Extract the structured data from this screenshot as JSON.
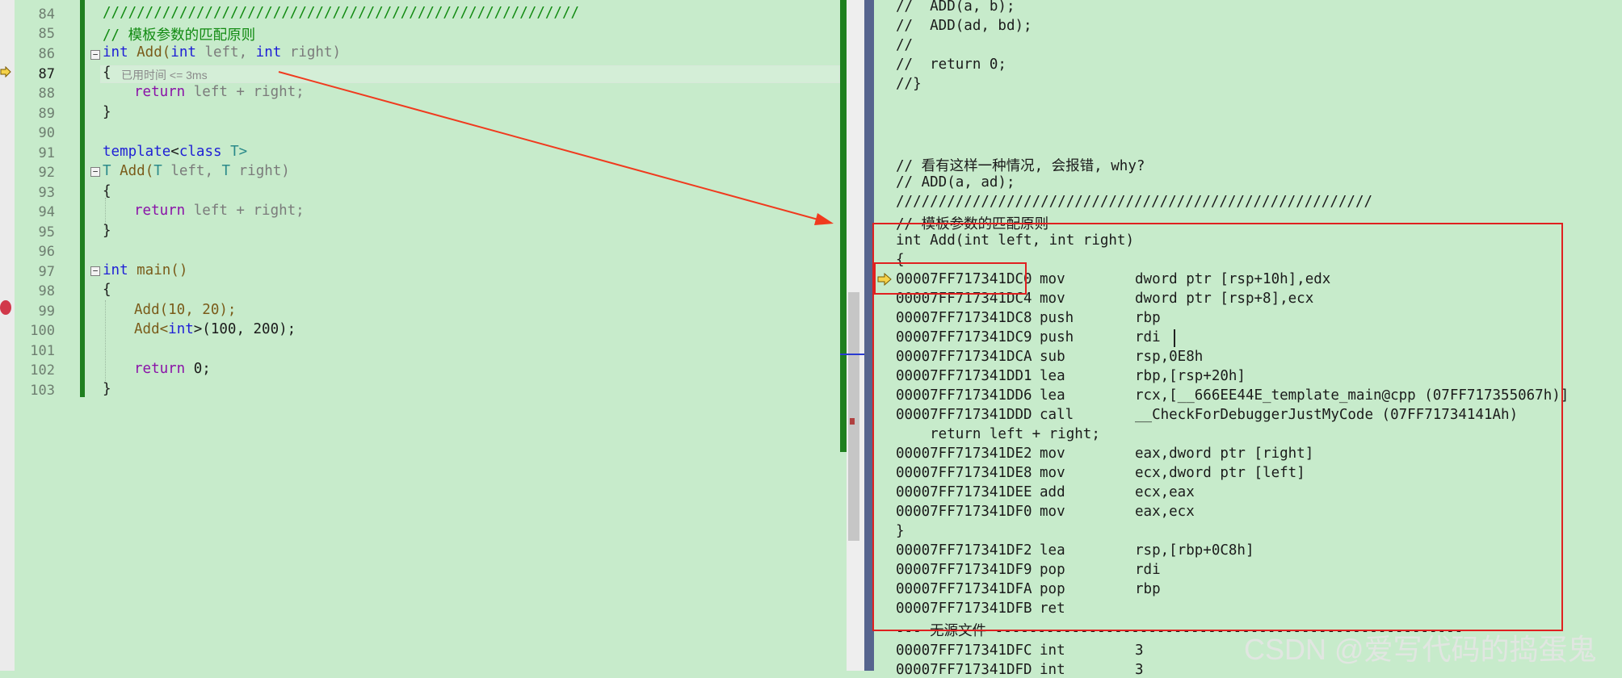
{
  "left_editor": {
    "elapsed_hint": "已用时间 <= 3ms",
    "lines": [
      {
        "n": "84",
        "t": "////////////////////////////////////////////////////////"
      },
      {
        "n": "85",
        "t": "// 模板参数的匹配原则"
      },
      {
        "n": "86",
        "a": "int",
        "b": " Add(",
        "c": "int",
        "d": " left, ",
        "e": "int",
        "f": " right)"
      },
      {
        "n": "87",
        "t": "{"
      },
      {
        "n": "88",
        "a": "return",
        "b": " left + right;"
      },
      {
        "n": "89",
        "t": "}"
      },
      {
        "n": "90",
        "t": ""
      },
      {
        "n": "91",
        "a": "template",
        "b": "<",
        "c": "class",
        "d": " T>"
      },
      {
        "n": "92",
        "a": "T",
        "b": " Add(",
        "c": "T",
        "d": " left, ",
        "e": "T",
        "f": " right)"
      },
      {
        "n": "93",
        "t": "{"
      },
      {
        "n": "94",
        "a": "return",
        "b": " left + right;"
      },
      {
        "n": "95",
        "t": "}"
      },
      {
        "n": "96",
        "t": ""
      },
      {
        "n": "97",
        "a": "int",
        "b": " main()"
      },
      {
        "n": "98",
        "t": "{"
      },
      {
        "n": "99",
        "t": "Add(10, 20);"
      },
      {
        "n": "100",
        "a": "Add<",
        "b": "int",
        "c": ">(100, 200);"
      },
      {
        "n": "101",
        "t": ""
      },
      {
        "n": "102",
        "a": "return",
        "b": " 0;"
      },
      {
        "n": "103",
        "t": "}"
      }
    ]
  },
  "disassembly": {
    "header": [
      "//  ADD(a, b);",
      "//  ADD(ad, bd);",
      "//",
      "//  return 0;",
      "//}",
      "",
      "",
      "",
      "// 看有这样一种情况, 会报错, why?",
      "// ADD(a, ad);",
      "////////////////////////////////////////////////////////",
      "// 模板参数的匹配原则",
      "int Add(int left, int right)",
      "{"
    ],
    "rows": [
      {
        "addr": "00007FF717341DC0",
        "mn": "mov",
        "op": "dword ptr [rsp+10h],edx"
      },
      {
        "addr": "00007FF717341DC4",
        "mn": "mov",
        "op": "dword ptr [rsp+8],ecx"
      },
      {
        "addr": "00007FF717341DC8",
        "mn": "push",
        "op": "rbp"
      },
      {
        "addr": "00007FF717341DC9",
        "mn": "push",
        "op": "rdi"
      },
      {
        "addr": "00007FF717341DCA",
        "mn": "sub",
        "op": "rsp,0E8h"
      },
      {
        "addr": "00007FF717341DD1",
        "mn": "lea",
        "op": "rbp,[rsp+20h]"
      },
      {
        "addr": "00007FF717341DD6",
        "mn": "lea",
        "op": "rcx,[__666EE44E_template_main@cpp (07FF717355067h)]"
      },
      {
        "addr": "00007FF717341DDD",
        "mn": "call",
        "op": "__CheckForDebuggerJustMyCode (07FF71734141Ah)"
      }
    ],
    "source_return": "    return left + right;",
    "rows2": [
      {
        "addr": "00007FF717341DE2",
        "mn": "mov",
        "op": "eax,dword ptr [right]"
      },
      {
        "addr": "00007FF717341DE8",
        "mn": "mov",
        "op": "ecx,dword ptr [left]"
      },
      {
        "addr": "00007FF717341DEE",
        "mn": "add",
        "op": "ecx,eax"
      },
      {
        "addr": "00007FF717341DF0",
        "mn": "mov",
        "op": "eax,ecx"
      }
    ],
    "close_brace": "}",
    "rows3": [
      {
        "addr": "00007FF717341DF2",
        "mn": "lea",
        "op": "rsp,[rbp+0C8h]"
      },
      {
        "addr": "00007FF717341DF9",
        "mn": "pop",
        "op": "rdi"
      },
      {
        "addr": "00007FF717341DFA",
        "mn": "pop",
        "op": "rbp"
      },
      {
        "addr": "00007FF717341DFB",
        "mn": "ret",
        "op": ""
      }
    ],
    "no_source": "--- 无源文件 -------------------------------------------------------",
    "rows4": [
      {
        "addr": "00007FF717341DFC",
        "mn": "int",
        "op": "3"
      },
      {
        "addr": "00007FF717341DFD",
        "mn": "int",
        "op": "3"
      }
    ]
  },
  "watermark": "CSDN @爱写代码的捣蛋鬼",
  "colors": {
    "background": "#c7ebcb",
    "keyword": "#1f1fd6",
    "comment": "#118a11",
    "annotation": "#e02020",
    "change_bar": "#1f7f1f"
  }
}
